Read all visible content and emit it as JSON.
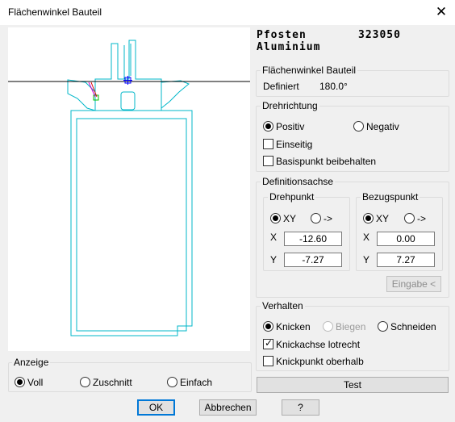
{
  "window": {
    "title": "Flächenwinkel Bauteil",
    "close_glyph": "✕"
  },
  "info": {
    "name": "Pfosten",
    "number": "323050",
    "material": "Aluminium"
  },
  "flaechenwinkel": {
    "legend": "Flächenwinkel Bauteil",
    "label": "Definiert",
    "value": "180.0°"
  },
  "drehrichtung": {
    "legend": "Drehrichtung",
    "positiv": "Positiv",
    "negativ": "Negativ",
    "einseitig": "Einseitig",
    "basispunkt": "Basispunkt beibehalten",
    "selected": "positiv",
    "einseitig_checked": false,
    "basispunkt_checked": false
  },
  "definitionsachse": {
    "legend": "Definitionsachse",
    "drehpunkt": {
      "legend": "Drehpunkt",
      "opt_xy": "XY",
      "opt_arrow": "->",
      "selected": "xy",
      "x_label": "X",
      "x_value": "-12.60",
      "y_label": "Y",
      "y_value": "-7.27"
    },
    "bezugspunkt": {
      "legend": "Bezugspunkt",
      "opt_xy": "XY",
      "opt_arrow": "->",
      "selected": "xy",
      "x_label": "X",
      "x_value": "0.00",
      "y_label": "Y",
      "y_value": "7.27"
    },
    "eingabe_label": "Eingabe <"
  },
  "verhalten": {
    "legend": "Verhalten",
    "knicken": "Knicken",
    "biegen": "Biegen",
    "schneiden": "Schneiden",
    "selected": "knicken",
    "lotrecht": "Knickachse lotrecht",
    "lotrecht_checked": true,
    "oberhalb": "Knickpunkt oberhalb",
    "oberhalb_checked": false
  },
  "test_label": "Test",
  "anzeige": {
    "legend": "Anzeige",
    "voll": "Voll",
    "zuschnitt": "Zuschnitt",
    "einfach": "Einfach",
    "selected": "voll"
  },
  "buttons": {
    "ok": "OK",
    "abbrechen": "Abbrechen",
    "help": "?"
  },
  "colors": {
    "profile": "#00b7c9",
    "focus": "#0078d7",
    "marker_green": "#00c000",
    "marker_magenta": "#d000d0",
    "marker_red": "#e00000",
    "marker_blue": "#0000ff"
  }
}
